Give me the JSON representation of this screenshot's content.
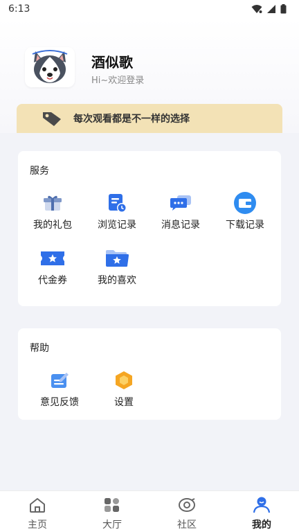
{
  "status_bar": {
    "time": "6:13"
  },
  "profile": {
    "name": "酒似歌",
    "subtitle": "Hi~欢迎登录"
  },
  "promo": {
    "text": "每次观看都是不一样的选择"
  },
  "services": {
    "title": "服务",
    "items": [
      {
        "label": "我的礼包",
        "icon": "gift-icon"
      },
      {
        "label": "浏览记录",
        "icon": "history-icon"
      },
      {
        "label": "消息记录",
        "icon": "message-icon"
      },
      {
        "label": "下载记录",
        "icon": "wallet-icon"
      },
      {
        "label": "代金券",
        "icon": "coupon-icon"
      },
      {
        "label": "我的喜欢",
        "icon": "favorite-folder-icon"
      }
    ]
  },
  "help": {
    "title": "帮助",
    "items": [
      {
        "label": "意见反馈",
        "icon": "feedback-icon"
      },
      {
        "label": "设置",
        "icon": "settings-icon"
      }
    ]
  },
  "tabs": [
    {
      "label": "主页",
      "icon": "home-icon",
      "active": false
    },
    {
      "label": "大厅",
      "icon": "hall-icon",
      "active": false
    },
    {
      "label": "社区",
      "icon": "community-icon",
      "active": false
    },
    {
      "label": "我的",
      "icon": "profile-icon",
      "active": true
    }
  ],
  "colors": {
    "accent_blue": "#2f6fe8",
    "promo_bg": "#f3e2b6",
    "settings_orange": "#f5a623"
  }
}
